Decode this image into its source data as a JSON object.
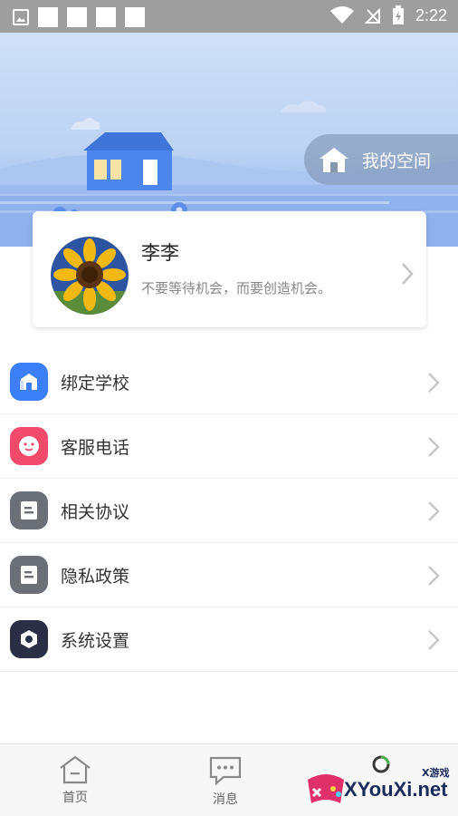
{
  "status_bar": {
    "time": "2:22"
  },
  "header": {
    "space_button_label": "我的空间"
  },
  "profile": {
    "name": "李李",
    "motto": "不要等待机会，而要创造机会。"
  },
  "menu": {
    "items": [
      {
        "label": "绑定学校",
        "icon": "school-icon",
        "color": "#3b7ef5"
      },
      {
        "label": "客服电话",
        "icon": "service-face-icon",
        "color": "#f24a6a"
      },
      {
        "label": "相关协议",
        "icon": "document-icon",
        "color": "#6b6f78"
      },
      {
        "label": "隐私政策",
        "icon": "document-icon",
        "color": "#6b6f78"
      },
      {
        "label": "系统设置",
        "icon": "settings-hexagon-icon",
        "color": "#2b2f45"
      }
    ]
  },
  "bottom_nav": {
    "tabs": [
      {
        "label": "首页",
        "icon": "home-icon"
      },
      {
        "label": "消息",
        "icon": "message-icon"
      }
    ]
  },
  "watermark": {
    "site": "XYouXi.net",
    "small": "X游戏"
  },
  "colors": {
    "status_bar": "#9e9e9e",
    "banner_top": "#cfe0f7",
    "banner_bottom": "#8aaeea"
  }
}
